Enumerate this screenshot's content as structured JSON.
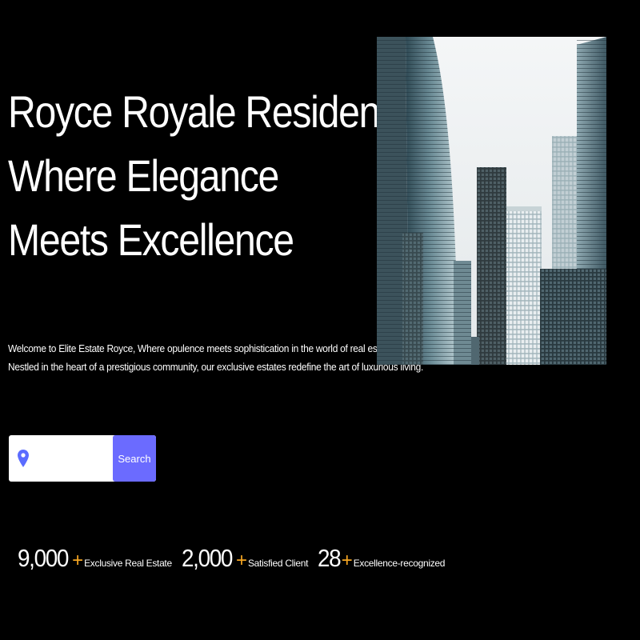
{
  "hero": {
    "title_line1": "Royce Royale Residences",
    "title_line2": "Where Elegance",
    "title_line3": "Meets Excellence",
    "intro_line1": "Welcome to Elite Estate Royce, Where opulence meets sophistication in the world of real estate.",
    "intro_line2": "Nestled in the heart of a prestigious community, our exclusive estates redefine the art of luxurious living."
  },
  "search": {
    "icon": "location-pin-icon",
    "placeholder": "",
    "value": "",
    "button_label": "Search"
  },
  "stats": [
    {
      "number": "9,000",
      "plus": "+",
      "label": "Exclusive Real Estate"
    },
    {
      "number": "2,000",
      "plus": "+",
      "label": "Satisfied Client"
    },
    {
      "number": "28",
      "plus": "+",
      "label": "Excellence-recognized"
    }
  ],
  "colors": {
    "background": "#000000",
    "text": "#ffffff",
    "accent_plus": "#f5a623",
    "search_button": "#6b6bff",
    "pin_icon": "#5b6cff"
  },
  "image": {
    "subject": "skyscrapers-photo"
  }
}
